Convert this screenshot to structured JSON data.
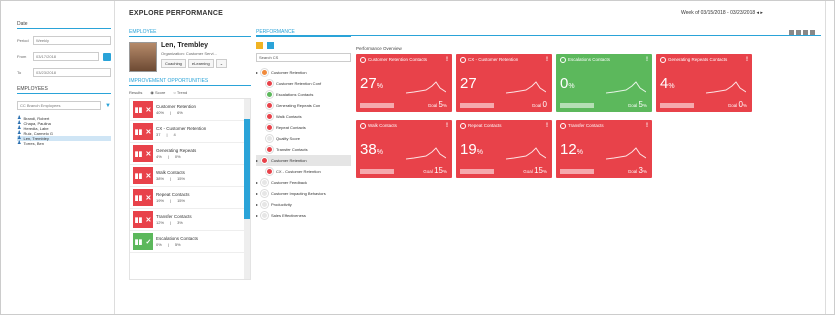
{
  "header": {
    "title": "EXPLORE PERFORMANCE",
    "week": "Week of 03/15/2018 - 03/23/2018"
  },
  "left": {
    "top_title": "Date",
    "period_label": "Period",
    "period_value": "Weekly",
    "from_label": "From",
    "from_value": "03/17/2018",
    "to_label": "To",
    "to_value": "03/23/2018",
    "employees_title": "EMPLOYEES",
    "filter_value": "CC Branch Employees",
    "employees": [
      "Brandi, Robert",
      "Chapa, Paulina",
      "Heredia, Labe",
      "Ruiz, Carmelo G",
      "Len, Trembley",
      "Torres, Ben"
    ],
    "selected_index": 4
  },
  "employee": {
    "section_title": "EMPLOYEE",
    "name": "Len, Trembley",
    "org": "Organization: Customer Servi...",
    "tabs": [
      "Coaching",
      "eLearning"
    ]
  },
  "improvement": {
    "section_title": "IMPROVEMENT OPPORTUNITIES",
    "results_label": "Results",
    "radio_score": "Score",
    "radio_trend": "Trend",
    "items": [
      {
        "name": "Customer Retention",
        "v1": "40%",
        "v2": "6%",
        "good": false
      },
      {
        "name": "CX - Customer Retention",
        "v1": "37",
        "v2": "4",
        "good": false
      },
      {
        "name": "Generating Repeats",
        "v1": "4%",
        "v2": "0%",
        "good": false
      },
      {
        "name": "Walk Contacts",
        "v1": "38%",
        "v2": "15%",
        "good": false
      },
      {
        "name": "Repeat Contacts",
        "v1": "19%",
        "v2": "15%",
        "good": false
      },
      {
        "name": "Transfer Contacts",
        "v1": "12%",
        "v2": "3%",
        "good": false
      },
      {
        "name": "Escalations Contacts",
        "v1": "0%",
        "v2": "5%",
        "good": true
      }
    ]
  },
  "performance": {
    "section_title": "PERFORMANCE",
    "search_value": "Search CS",
    "tree": [
      {
        "label": "Customer Retention",
        "dot": "o",
        "child": false,
        "hl": false
      },
      {
        "label": "Customer Retention Conf",
        "dot": "r",
        "child": true,
        "hl": false
      },
      {
        "label": "Escalations Contacts",
        "dot": "g",
        "child": true,
        "hl": false
      },
      {
        "label": "Generating Repeats Con",
        "dot": "r",
        "child": true,
        "hl": false
      },
      {
        "label": "Walk Contacts",
        "dot": "r",
        "child": true,
        "hl": false
      },
      {
        "label": "Repeat Contacts",
        "dot": "r",
        "child": true,
        "hl": false
      },
      {
        "label": "Quality Score",
        "dot": "gr",
        "child": true,
        "hl": false
      },
      {
        "label": "Transfer Contacts",
        "dot": "r",
        "child": true,
        "hl": false
      },
      {
        "label": "Customer Retention",
        "dot": "r",
        "child": false,
        "hl": true
      },
      {
        "label": "CX - Customer Retention",
        "dot": "r",
        "child": true,
        "hl": false
      },
      {
        "label": "Customer Feedback",
        "dot": "gr",
        "child": false,
        "hl": false
      },
      {
        "label": "Customer Impacting Behaviors",
        "dot": "gr",
        "child": false,
        "hl": false
      },
      {
        "label": "Productivity",
        "dot": "gr",
        "child": false,
        "hl": false
      },
      {
        "label": "Sales Effectiveness",
        "dot": "gr",
        "child": false,
        "hl": false
      }
    ]
  },
  "dashboard": {
    "title": "Performance Overview",
    "tiles": [
      {
        "name": "Customer Retention Contacts",
        "value": "27",
        "unit": "%",
        "goal_label": "Goal",
        "goal": "5",
        "goal_unit": "%",
        "color": "#e8424a"
      },
      {
        "name": "CX - Customer Retention",
        "value": "27",
        "unit": "",
        "goal_label": "Goal",
        "goal": "0",
        "goal_unit": "",
        "color": "#e8424a"
      },
      {
        "name": "Escalations Contacts",
        "value": "0",
        "unit": "%",
        "goal_label": "Goal",
        "goal": "5",
        "goal_unit": "%",
        "color": "#5cb85c"
      },
      {
        "name": "Generating Repeats Contacts",
        "value": "4",
        "unit": "%",
        "goal_label": "Goal",
        "goal": "0",
        "goal_unit": "%",
        "color": "#e8424a"
      },
      {
        "name": "Walk Contacts",
        "value": "38",
        "unit": "%",
        "goal_label": "Goal",
        "goal": "15",
        "goal_unit": "%",
        "color": "#e8424a"
      },
      {
        "name": "Repeat Contacts",
        "value": "19",
        "unit": "%",
        "goal_label": "Goal",
        "goal": "15",
        "goal_unit": "%",
        "color": "#e8424a"
      },
      {
        "name": "Transfer Contacts",
        "value": "12",
        "unit": "%",
        "goal_label": "Goal",
        "goal": "3",
        "goal_unit": "%",
        "color": "#e8424a"
      }
    ]
  }
}
